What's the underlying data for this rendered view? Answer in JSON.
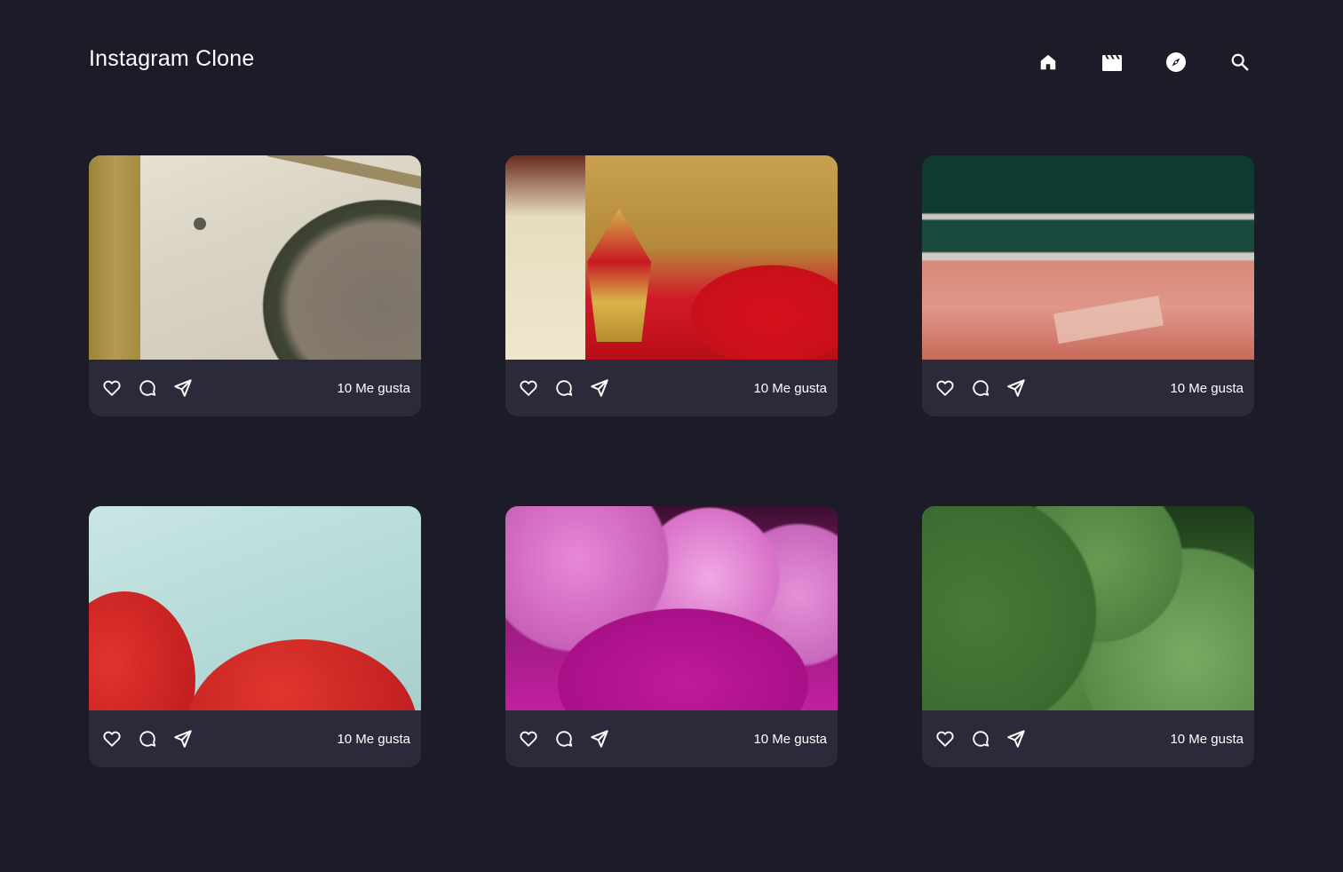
{
  "app": {
    "title": "Instagram Clone"
  },
  "nav": {
    "items": [
      {
        "name": "home",
        "icon": "home-icon"
      },
      {
        "name": "reels",
        "icon": "clapperboard-icon"
      },
      {
        "name": "explore",
        "icon": "compass-icon"
      },
      {
        "name": "search",
        "icon": "search-icon"
      }
    ]
  },
  "posts": [
    {
      "likes_label": "10 Me gusta"
    },
    {
      "likes_label": "10 Me gusta"
    },
    {
      "likes_label": "10 Me gusta"
    },
    {
      "likes_label": "10 Me gusta"
    },
    {
      "likes_label": "10 Me gusta"
    },
    {
      "likes_label": "10 Me gusta"
    }
  ],
  "colors": {
    "background": "#1c1c29",
    "card_footer": "#2a2a3a",
    "text": "#ffffff"
  }
}
